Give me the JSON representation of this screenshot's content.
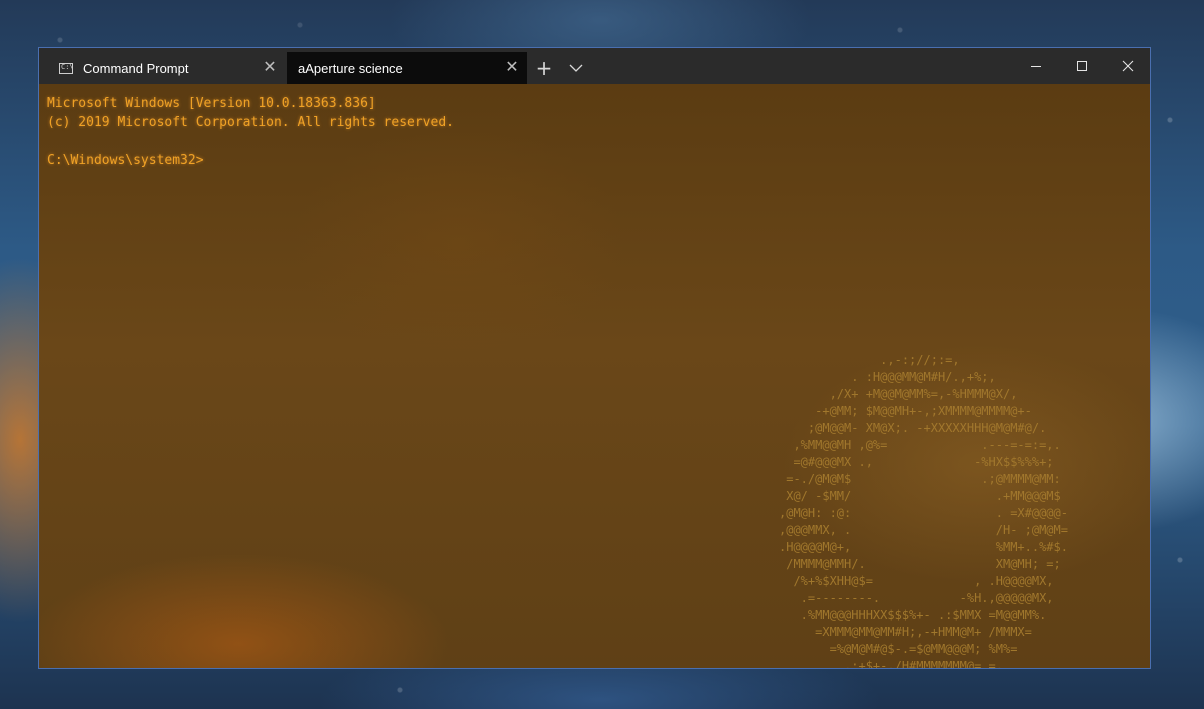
{
  "tabs": [
    {
      "label": "Command Prompt",
      "icon": "cmd-icon",
      "active": false
    },
    {
      "label": "aAperture science",
      "active": true
    }
  ],
  "titlebar": {
    "close_tab_glyph": "✕",
    "new_tab_glyph": "+"
  },
  "console": {
    "lines": [
      "Microsoft Windows [Version 10.0.18363.836]",
      "(c) 2019 Microsoft Corporation. All rights reserved.",
      "",
      "C:\\Windows\\system32>"
    ],
    "text_color": "#f0a226"
  },
  "background_art": {
    "lines": [
      "              .,-:;//;:=,",
      "          . :H@@@MM@M#H/.,+%;,",
      "       ,/X+ +M@@M@MM%=,-%HMMM@X/,",
      "     -+@MM; $M@@MH+-,;XMMMM@MMMM@+-",
      "    ;@M@@M- XM@X;. -+XXXXXHHH@M@M#@/.",
      "  ,%MM@@MH ,@%=             .---=-=:=,.",
      "  =@#@@@MX .,              -%HX$$%%%+;",
      " =-./@M@M$                  .;@MMMM@MM:",
      " X@/ -$MM/                    .+MM@@@M$",
      ",@M@H: :@:                    . =X#@@@@-",
      ",@@@MMX, .                    /H- ;@M@M=",
      ".H@@@@M@+,                    %MM+..%#$.",
      " /MMMM@MMH/.                  XM@MH; =;",
      "  /%+%$XHH@$=              , .H@@@@MX,",
      "   .=--------.           -%H.,@@@@@MX,",
      "   .%MM@@@HHHXX$$$%+- .:$MMX =M@@MM%.",
      "     =XMMM@MM@MM#H;,-+HMM@M+ /MMMX=",
      "       =%@M@M#@$-.=$@MM@@@M; %M%=",
      "         ,:+$+-,/H#MMMMMMM@= =,",
      "               =++%%%%+/:-."
    ],
    "text_color": "#a47a2e"
  }
}
